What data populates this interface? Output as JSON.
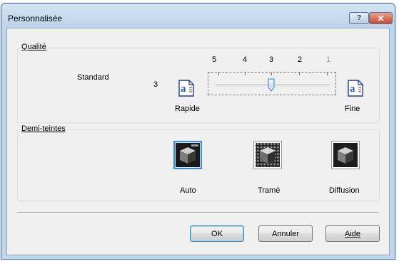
{
  "window": {
    "title": "Personnalisée"
  },
  "titlebar_buttons": {
    "help": "?",
    "close": "✕"
  },
  "quality": {
    "group_label": "Qualité",
    "mode_label": "Standard",
    "current_value": "3",
    "scale_labels": [
      "5",
      "4",
      "3",
      "2",
      "1"
    ],
    "slider_value": 3,
    "left_label": "Rapide",
    "right_label": "Fine",
    "icon_glyph": "a"
  },
  "halftone": {
    "group_label": "Demi-teintes",
    "options": [
      {
        "label": "Auto",
        "selected": true
      },
      {
        "label": "Tramé",
        "selected": false
      },
      {
        "label": "Diffusion",
        "selected": false
      }
    ]
  },
  "buttons": {
    "ok": "OK",
    "cancel": "Annuler",
    "help": "Aide"
  },
  "colors": {
    "accent": "#3d8ede",
    "titlebar": "#bfd6ee",
    "close": "#c94a33"
  }
}
